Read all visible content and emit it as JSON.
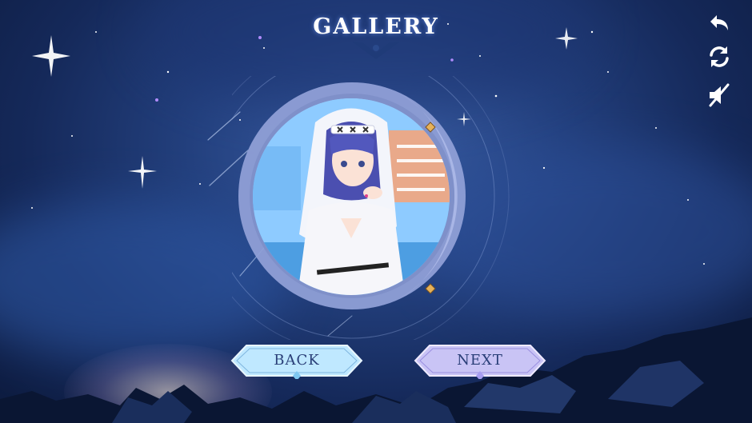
{
  "screen": {
    "title": "GALLERY",
    "buttons": {
      "back_label": "BACK",
      "next_label": "NEXT"
    },
    "side_icons": [
      "back-arrow-icon",
      "refresh-icon",
      "mute-icon"
    ],
    "colors": {
      "sky_dark": "#0c1a3d",
      "sky_light": "#3b5fa6",
      "frame": "#8f9fd6",
      "back_button": "#bfe8ff",
      "next_button": "#c9c4f5",
      "title": "#ffffff"
    }
  }
}
